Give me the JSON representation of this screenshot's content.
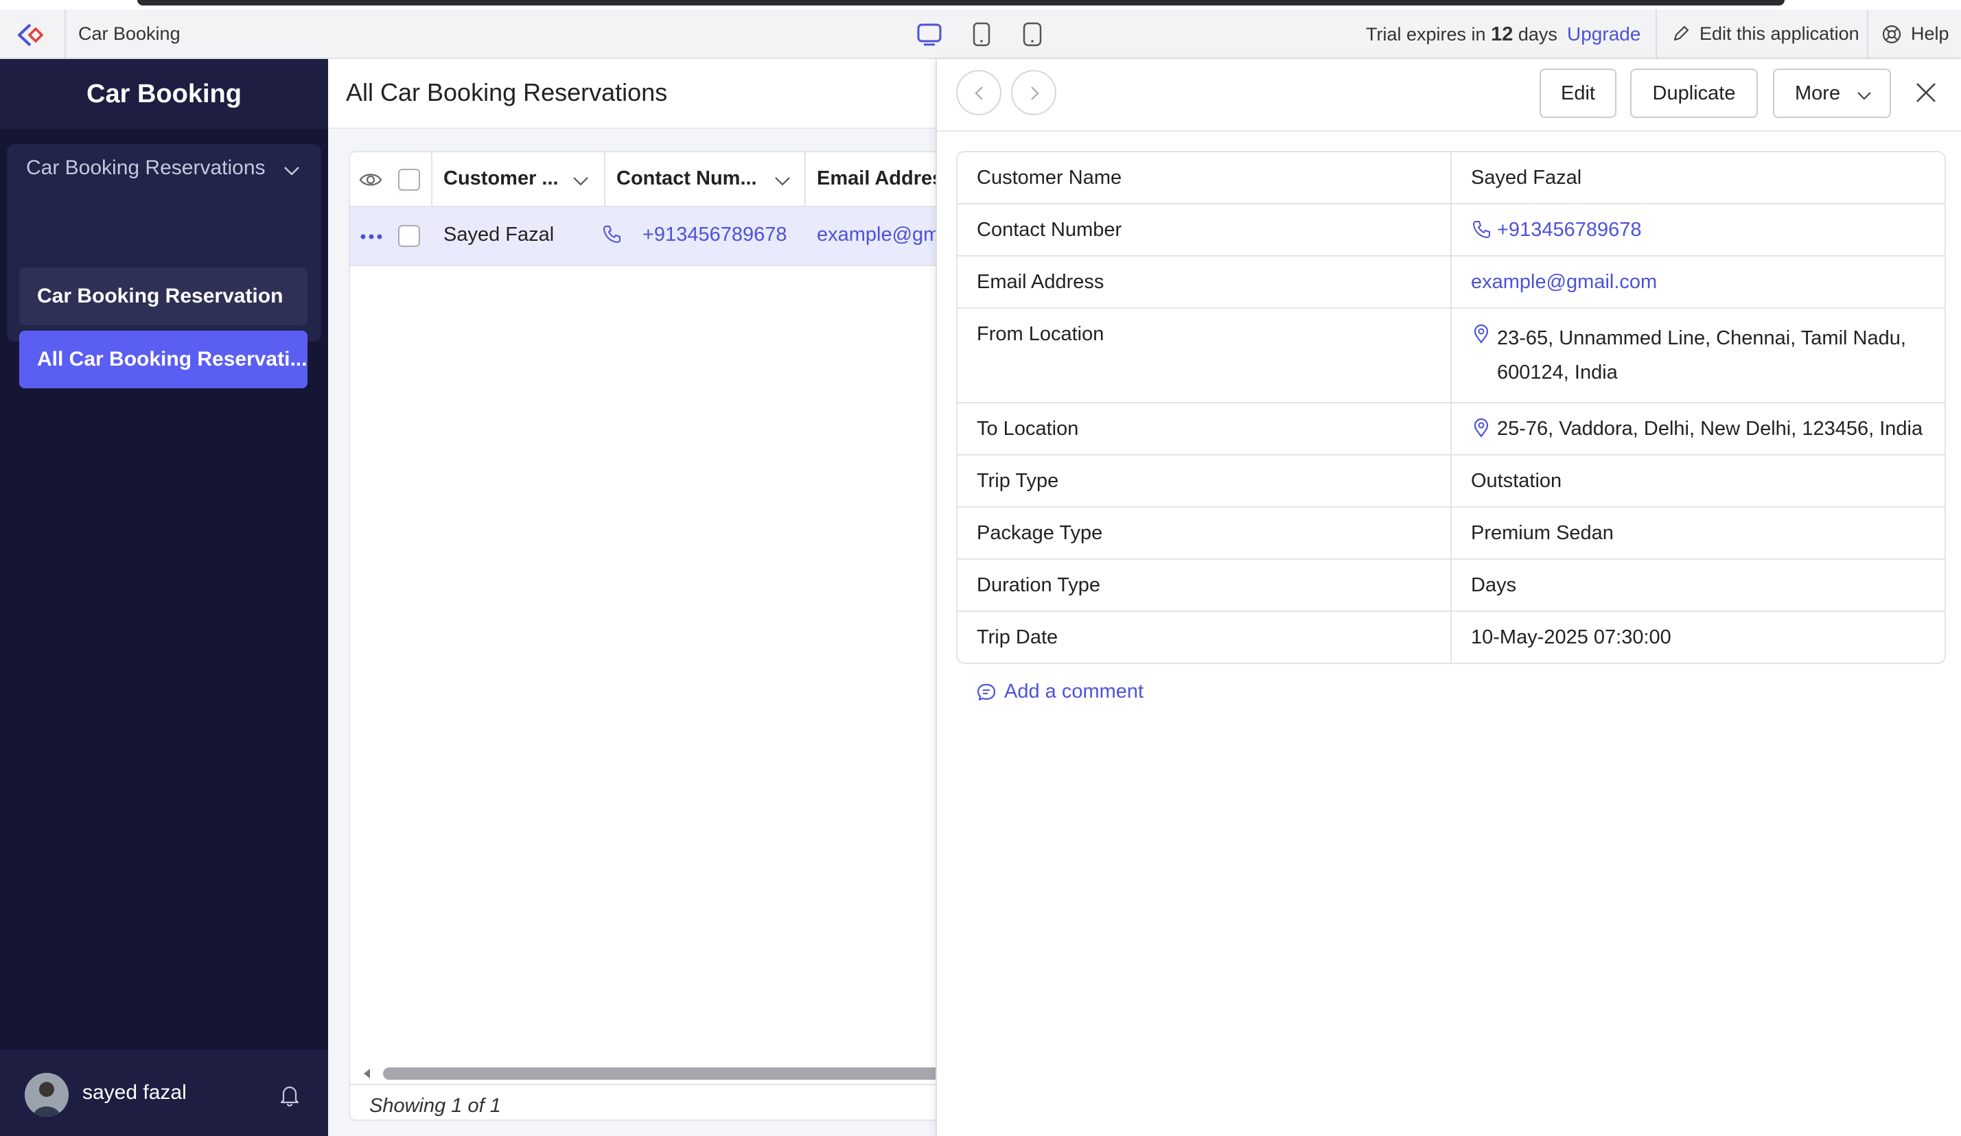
{
  "topbar": {
    "app_name": "Car Booking",
    "trial_prefix": "Trial expires in",
    "trial_days": "12",
    "trial_suffix": "days",
    "upgrade": "Upgrade",
    "edit_app": "Edit this application",
    "help": "Help",
    "device_icons": [
      "desktop-icon",
      "tablet-icon",
      "mobile-icon"
    ]
  },
  "sidebar": {
    "title": "Car Booking",
    "group_label": "Car Booking Reservations",
    "items": [
      {
        "label": "Car Booking Reservation",
        "active": false
      },
      {
        "label": "All Car Booking Reservati...",
        "active": true
      }
    ],
    "user_name": "sayed fazal"
  },
  "list": {
    "title": "All Car Booking Reservations",
    "columns": [
      "Customer ...",
      "Contact Num...",
      "Email Addres"
    ],
    "rows": [
      {
        "customer": "Sayed Fazal",
        "contact": "+913456789678",
        "email": "example@gm"
      }
    ],
    "footer": "Showing 1 of 1"
  },
  "detail": {
    "buttons": {
      "edit": "Edit",
      "duplicate": "Duplicate",
      "more": "More"
    },
    "fields": [
      {
        "label": "Customer Name",
        "value": "Sayed Fazal"
      },
      {
        "label": "Contact Number",
        "value": "+913456789678"
      },
      {
        "label": "Email Address",
        "value": "example@gmail.com"
      },
      {
        "label": "From Location",
        "value": "23-65, Unnammed Line, Chennai, Tamil Nadu, 600124, India"
      },
      {
        "label": "To Location",
        "value": "25-76, Vaddora, Delhi, New Delhi, 123456, India"
      },
      {
        "label": "Trip Type",
        "value": "Outstation"
      },
      {
        "label": "Package Type",
        "value": "Premium Sedan"
      },
      {
        "label": "Duration Type",
        "value": "Days"
      },
      {
        "label": "Trip Date",
        "value": "10-May-2025 07:30:00"
      }
    ],
    "add_comment": "Add a comment"
  },
  "colors": {
    "accent": "#5b5ef2",
    "link": "#4c52d8",
    "sidebar_bg": "#151633",
    "row_selected": "#e9eafb"
  }
}
